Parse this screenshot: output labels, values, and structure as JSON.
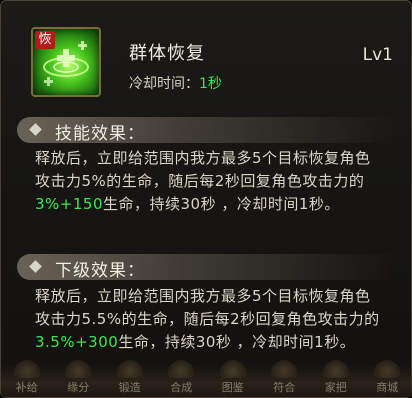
{
  "skill": {
    "icon_tag": "恢",
    "name": "群体恢复",
    "level": "Lv1",
    "cooldown_label": "冷却时间：",
    "cooldown_value": "1秒"
  },
  "current_effect": {
    "title": "技能效果：",
    "text_before": "释放后，立即给范围内我方最多5个目标恢复角色攻击力5%的生命，随后每2秒回复角色攻击力的",
    "highlight": "3%+150",
    "text_after": "生命，持续30秒 ，冷却时间1秒。"
  },
  "next_effect": {
    "title": "下级效果：",
    "text_before": "释放后，立即给范围内我方最多5个目标恢复角色攻击力5.5%的生命，随后每2秒回复角色攻击力的",
    "highlight": "3.5%+300",
    "text_after": "生命，持续30秒 ，冷却时间1秒。"
  },
  "bottom_menu": [
    "补给",
    "缘分",
    "锻造",
    "合成",
    "图鉴",
    "符合",
    "家把",
    "商城"
  ],
  "colors": {
    "highlight": "#3be84a",
    "panel_border": "#4a4236",
    "icon_green": "#49c51e",
    "tag_red": "#b51b1b"
  }
}
